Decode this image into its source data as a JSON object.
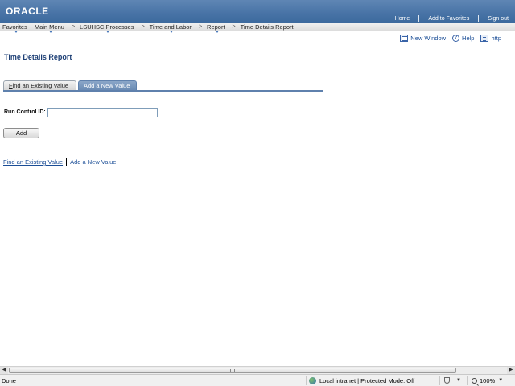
{
  "header": {
    "logo": "ORACLE",
    "links": {
      "home": "Home",
      "favorites": "Add to Favorites",
      "signout": "Sign out"
    }
  },
  "menubar": {
    "favorites": "Favorites",
    "main_menu": "Main Menu",
    "breadcrumbs": [
      "LSUHSC Processes",
      "Time and Labor",
      "Report",
      "Time Details Report"
    ]
  },
  "page_actions": {
    "new_window": "New Window",
    "help": "Help",
    "http": "http"
  },
  "page": {
    "title": "Time Details Report"
  },
  "tabs": {
    "find_prefix": "F",
    "find_rest": "ind an Existing Value",
    "add": "Add a New Value",
    "active": "Add a New Value"
  },
  "form": {
    "run_control_label": "Run Control ID:",
    "run_control_value": "",
    "add_button": "Add"
  },
  "bottom_links": {
    "find": "Find an Existing Value",
    "add": "Add a New Value"
  },
  "statusbar": {
    "left": "Done",
    "zone": "Local intranet | Protected Mode: Off",
    "zoom": "100%"
  },
  "icons": {
    "new_window": "new-window-icon",
    "help": "help-icon",
    "http": "http-icon",
    "zone": "globe-icon",
    "protected": "shield-icon",
    "zoom": "magnifier-icon"
  },
  "colors": {
    "header_blue": "#4873a6",
    "tab_active": "#6a8bb4",
    "link": "#1a4d96",
    "title": "#1d3f75"
  }
}
